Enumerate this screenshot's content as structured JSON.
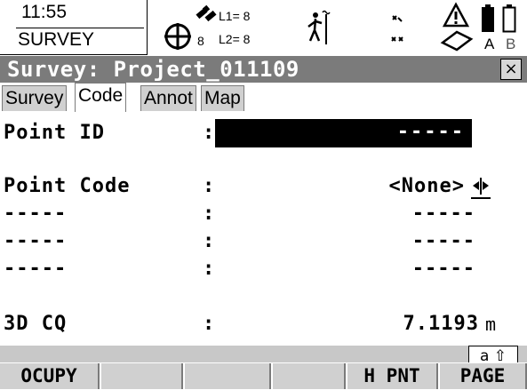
{
  "status": {
    "time": "11:55",
    "mode": "SURVEY",
    "sat_count": "8",
    "sat_count_l": "8",
    "l1_label": "L1= 8",
    "l2_label": "L2= 8",
    "battery_a": "A",
    "battery_b": "B"
  },
  "window": {
    "title": "Survey: Project_011109",
    "close_label": "×"
  },
  "tabs": [
    {
      "label": "Survey"
    },
    {
      "label": "Code"
    },
    {
      "label": "Annot"
    },
    {
      "label": "Map"
    }
  ],
  "fields": {
    "point_id": {
      "label": "Point ID",
      "sep": ":",
      "value": "-----"
    },
    "point_code": {
      "label": "Point Code",
      "sep": ":",
      "value": "<None>"
    },
    "attr1": {
      "label": "-----",
      "sep": ":",
      "value": "-----"
    },
    "attr2": {
      "label": "-----",
      "sep": ":",
      "value": "-----"
    },
    "attr3": {
      "label": "-----",
      "sep": ":",
      "value": "-----"
    },
    "cq3d": {
      "label": "3D CQ",
      "sep": ":",
      "value": "7.1193",
      "unit": "m"
    }
  },
  "input_mode": "a ⇧",
  "softkeys": [
    "OCUPY",
    "",
    "",
    "",
    "H PNT",
    "PAGE"
  ],
  "colors": {
    "title_bar": "#7b7b7b",
    "tab_inactive": "#d0d0d0",
    "softkey": "#d0d0d0",
    "field_active": "#000000"
  }
}
